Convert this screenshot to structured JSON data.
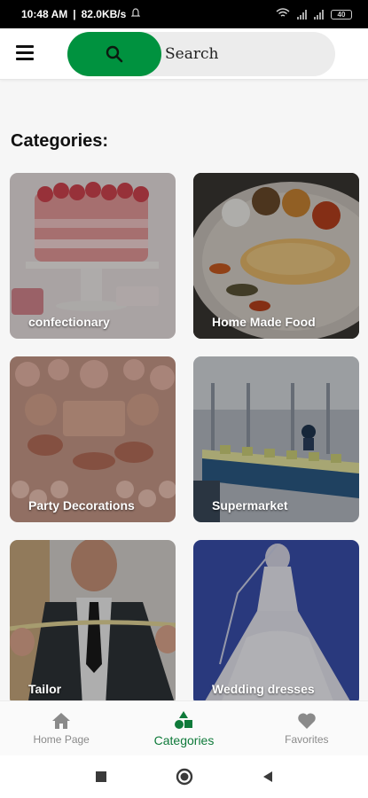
{
  "status_bar": {
    "time": "10:48 AM",
    "speed": "82.0KB/s",
    "battery": "40"
  },
  "header": {
    "search_placeholder": "Search"
  },
  "main": {
    "section_title": "Categories:",
    "categories": [
      {
        "label": "confectionary"
      },
      {
        "label": "Home Made Food"
      },
      {
        "label": "Party Decorations"
      },
      {
        "label": "Supermarket"
      },
      {
        "label": "Tailor"
      },
      {
        "label": "Wedding dresses"
      }
    ]
  },
  "bottom_nav": {
    "items": [
      {
        "label": "Home Page",
        "icon": "home-icon",
        "active": false
      },
      {
        "label": "Categories",
        "icon": "categories-icon",
        "active": true
      },
      {
        "label": "Favorites",
        "icon": "heart-icon",
        "active": false
      }
    ]
  },
  "colors": {
    "accent": "#00923f",
    "active_nav": "#0f7a3a",
    "inactive_nav": "#8a8a8a"
  }
}
